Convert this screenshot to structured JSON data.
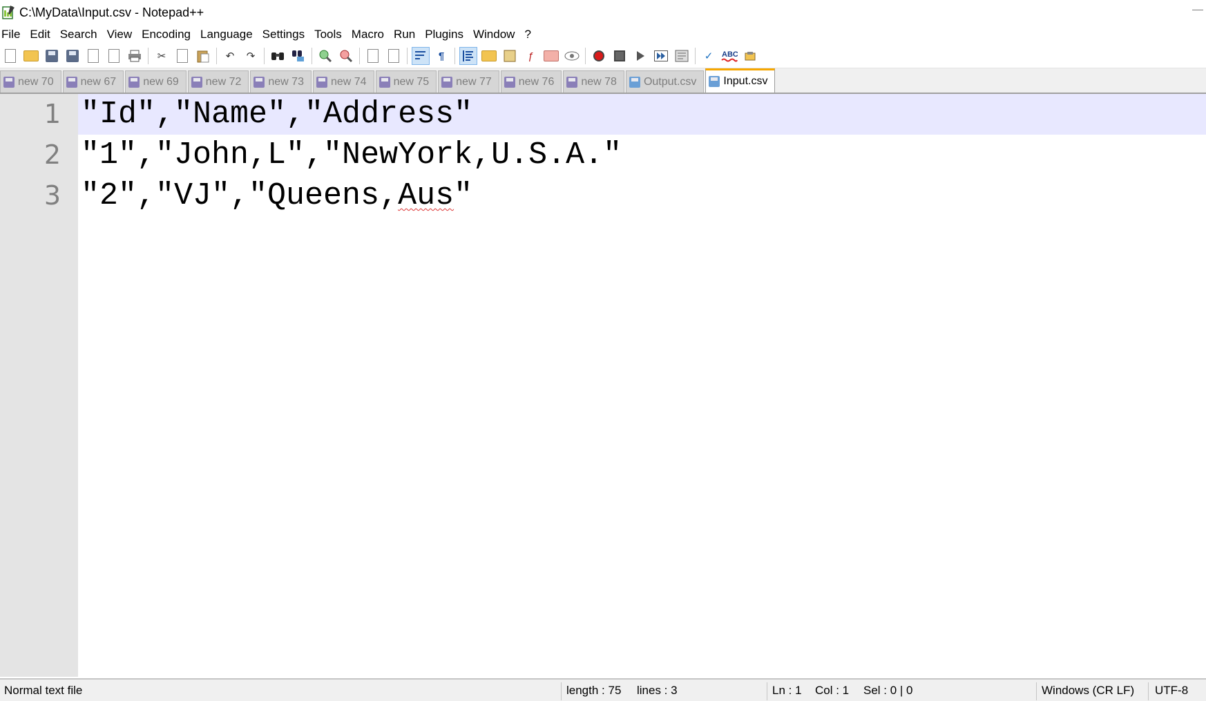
{
  "window": {
    "title": "C:\\MyData\\Input.csv - Notepad++"
  },
  "menu": [
    "File",
    "Edit",
    "Search",
    "View",
    "Encoding",
    "Language",
    "Settings",
    "Tools",
    "Macro",
    "Run",
    "Plugins",
    "Window",
    "?"
  ],
  "toolbar": {
    "buttons": [
      "new-file",
      "open-file",
      "save",
      "save-all",
      "close",
      "close-all",
      "print",
      "cut",
      "copy",
      "paste",
      "undo",
      "redo",
      "find",
      "replace",
      "zoom-in",
      "zoom-out",
      "sync-vertical",
      "sync-horizontal",
      "word-wrap",
      "show-all-characters",
      "indent-guide",
      "define-language",
      "document-map",
      "function-list",
      "folder-as-workspace",
      "monitoring",
      "start-recording",
      "stop-recording",
      "playback",
      "run-macro-multiple",
      "save-macro",
      "spell-check",
      "spell-check-abc",
      "plugin-tool"
    ],
    "active": [
      "word-wrap",
      "indent-guide"
    ]
  },
  "tabs": [
    {
      "label": "new 70",
      "state": "unsaved",
      "active": false
    },
    {
      "label": "new 67",
      "state": "unsaved",
      "active": false
    },
    {
      "label": "new 69",
      "state": "unsaved",
      "active": false
    },
    {
      "label": "new 72",
      "state": "unsaved",
      "active": false
    },
    {
      "label": "new 73",
      "state": "unsaved",
      "active": false
    },
    {
      "label": "new 74",
      "state": "unsaved",
      "active": false
    },
    {
      "label": "new 75",
      "state": "unsaved",
      "active": false
    },
    {
      "label": "new 77",
      "state": "unsaved",
      "active": false
    },
    {
      "label": "new 76",
      "state": "unsaved",
      "active": false
    },
    {
      "label": "new 78",
      "state": "unsaved",
      "active": false
    },
    {
      "label": "Output.csv",
      "state": "saved",
      "active": false
    },
    {
      "label": "Input.csv",
      "state": "saved",
      "active": true
    }
  ],
  "editor": {
    "lines": [
      {
        "num": "1",
        "text": "\"Id\",\"Name\",\"Address\""
      },
      {
        "num": "2",
        "text": "\"1\",\"John,L\",\"NewYork,U.S.A.\""
      },
      {
        "num": "3",
        "text": "\"2\",\"VJ\",\"Queens,Aus\""
      }
    ],
    "current_line": 1,
    "spellcheck_flag": "Aus"
  },
  "status": {
    "file_type": "Normal text file",
    "length": "length : 75",
    "lines": "lines : 3",
    "ln": "Ln : 1",
    "col": "Col : 1",
    "sel": "Sel : 0 | 0",
    "eol": "Windows (CR LF)",
    "encoding": "UTF-8"
  },
  "colors": {
    "active_tab_accent": "#f7a700",
    "current_line_bg": "#e8e8ff",
    "gutter_bg": "#e4e4e4"
  }
}
